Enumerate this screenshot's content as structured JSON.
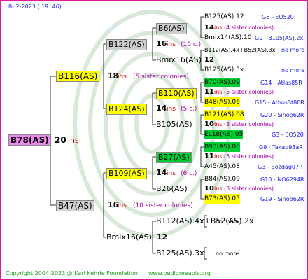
{
  "header": {
    "date": "8-  2-2023  ( 19:  46)"
  },
  "footer": {
    "copyright": "Copyright 2004-2023 @ Karl Kehrle Foundation",
    "site": "www.pedigreeapis.org"
  },
  "root": {
    "name": "B78(AS)",
    "count": "20",
    "ins": "ins"
  },
  "gen1": {
    "top": {
      "name": "B116(AS)",
      "count": "18",
      "ins": "ins",
      "sis": "(5 sister colonies)"
    },
    "bottom": {
      "name": "B47(AS)",
      "count": "16",
      "ins": "ins",
      "sis": "(10 sister colonies)"
    }
  },
  "gen2": {
    "a": {
      "name": "B122(AS)"
    },
    "b": {
      "name": "B124(AS)",
      "count": "14",
      "ins": "ins",
      "sis": "(5 c.)"
    },
    "c": {
      "name": "B109(AS)",
      "count": "14",
      "ins": "ins",
      "sis": "(6 c.)"
    },
    "d": {
      "name": "Bmix16(AS)",
      "count": "12"
    }
  },
  "gen3": {
    "a1": {
      "name": "B6(AS)",
      "count": "16",
      "ins": "ins",
      "sis": "(10 c.)"
    },
    "a2": {
      "name": "Bmix16(AS)",
      "count": "12"
    },
    "b1": {
      "name": "B110(AS)",
      "count": "14",
      "ins": "ins",
      "sis": "(5 c.)"
    },
    "b2": {
      "name": "B105(AS)"
    },
    "c1": {
      "name": "B27(AS)",
      "count": "14",
      "ins": "ins",
      "sis": "(6 c.)"
    },
    "c2": {
      "name": "B26(AS)"
    },
    "d1": {
      "name": "B112(AS).4x+B52(AS).2x"
    },
    "d2": {
      "name": "B125(AS).3x"
    }
  },
  "gen4": {
    "r1": {
      "name": "B125(AS).12",
      "info": "G6 - EO520"
    },
    "r2": {
      "count": "14",
      "ins": "ins",
      "sis": "(4 sister colonies)"
    },
    "r3": {
      "name": "Bmix14(AS).10",
      "info": "G0 - B105(AS).2x"
    },
    "r4": {
      "name": "B112(AS).4x+B52(AS).3x",
      "info": "no more"
    },
    "r5": {
      "count": "12"
    },
    "r6": {
      "name": "B125(AS).3x",
      "info": "no more"
    },
    "r7": {
      "name": "B70(AS).09",
      "info": "G14 - Atlas85R"
    },
    "r8": {
      "count": "11",
      "ins": "ins",
      "sis": "(5 sister colonies)"
    },
    "r9": {
      "name": "B48(AS).06",
      "info": "G15 - AthosSt80R"
    },
    "r10": {
      "name": "B121(AS).08",
      "info": "G20 - Sinop62R"
    },
    "r11": {
      "count": "10",
      "ins": "ins",
      "sis": "(3 sister colonies)"
    },
    "r12": {
      "name": "EL18(AS).05",
      "info": "G3 - EO520"
    },
    "r13": {
      "name": "B93(AS).08",
      "info": "G9 - Takab93aR"
    },
    "r14": {
      "count": "11",
      "ins": "ins",
      "sis": "(5 sister colonies)"
    },
    "r15": {
      "name": "A45(AS).08",
      "info": "G3 - Bozdag07R"
    },
    "r16": {
      "name": "B84(AS).09",
      "info": "G10 - NO6294R"
    },
    "r17": {
      "count": "10",
      "ins": "ins",
      "sis": "(3 sister colonies)"
    },
    "r18": {
      "name": "B73(AS).05",
      "info": "G19 - Sinop62R"
    },
    "r19": {
      "text": "no more"
    },
    "r20": {
      "text": "no more"
    }
  },
  "colors": {
    "border": "#e0189a",
    "highlight_yellow": "#ffff00",
    "highlight_green": "#00cc33",
    "root_pink": "#ee88ee",
    "ins_red": "#dd0000",
    "info_blue": "#1a1aee"
  }
}
